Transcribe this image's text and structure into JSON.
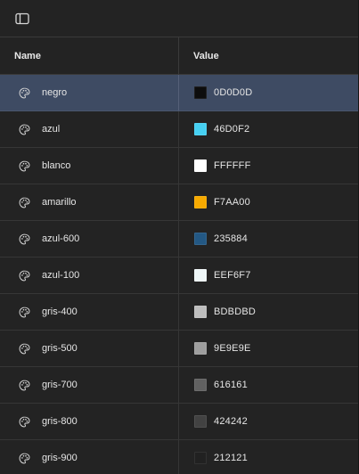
{
  "toolbar": {
    "sidebar_toggle_icon": "sidebar-panel-icon"
  },
  "table": {
    "columns": {
      "name": "Name",
      "value": "Value"
    },
    "selected_index": 0,
    "rows": [
      {
        "name": "negro",
        "value": "0D0D0D",
        "color": "#0D0D0D"
      },
      {
        "name": "azul",
        "value": "46D0F2",
        "color": "#46D0F2"
      },
      {
        "name": "blanco",
        "value": "FFFFFF",
        "color": "#FFFFFF"
      },
      {
        "name": "amarillo",
        "value": "F7AA00",
        "color": "#F7AA00"
      },
      {
        "name": "azul-600",
        "value": "235884",
        "color": "#235884"
      },
      {
        "name": "azul-100",
        "value": "EEF6F7",
        "color": "#EEF6F7"
      },
      {
        "name": "gris-400",
        "value": "BDBDBD",
        "color": "#BDBDBD"
      },
      {
        "name": "gris-500",
        "value": "9E9E9E",
        "color": "#9E9E9E"
      },
      {
        "name": "gris-700",
        "value": "616161",
        "color": "#616161"
      },
      {
        "name": "gris-800",
        "value": "424242",
        "color": "#424242"
      },
      {
        "name": "gris-900",
        "value": "212121",
        "color": "#212121"
      }
    ]
  },
  "icons": {
    "row_icon": "palette-icon"
  },
  "colors": {
    "background": "#232323",
    "selected_row": "#3E4B63",
    "divider": "#3A3A3A"
  }
}
